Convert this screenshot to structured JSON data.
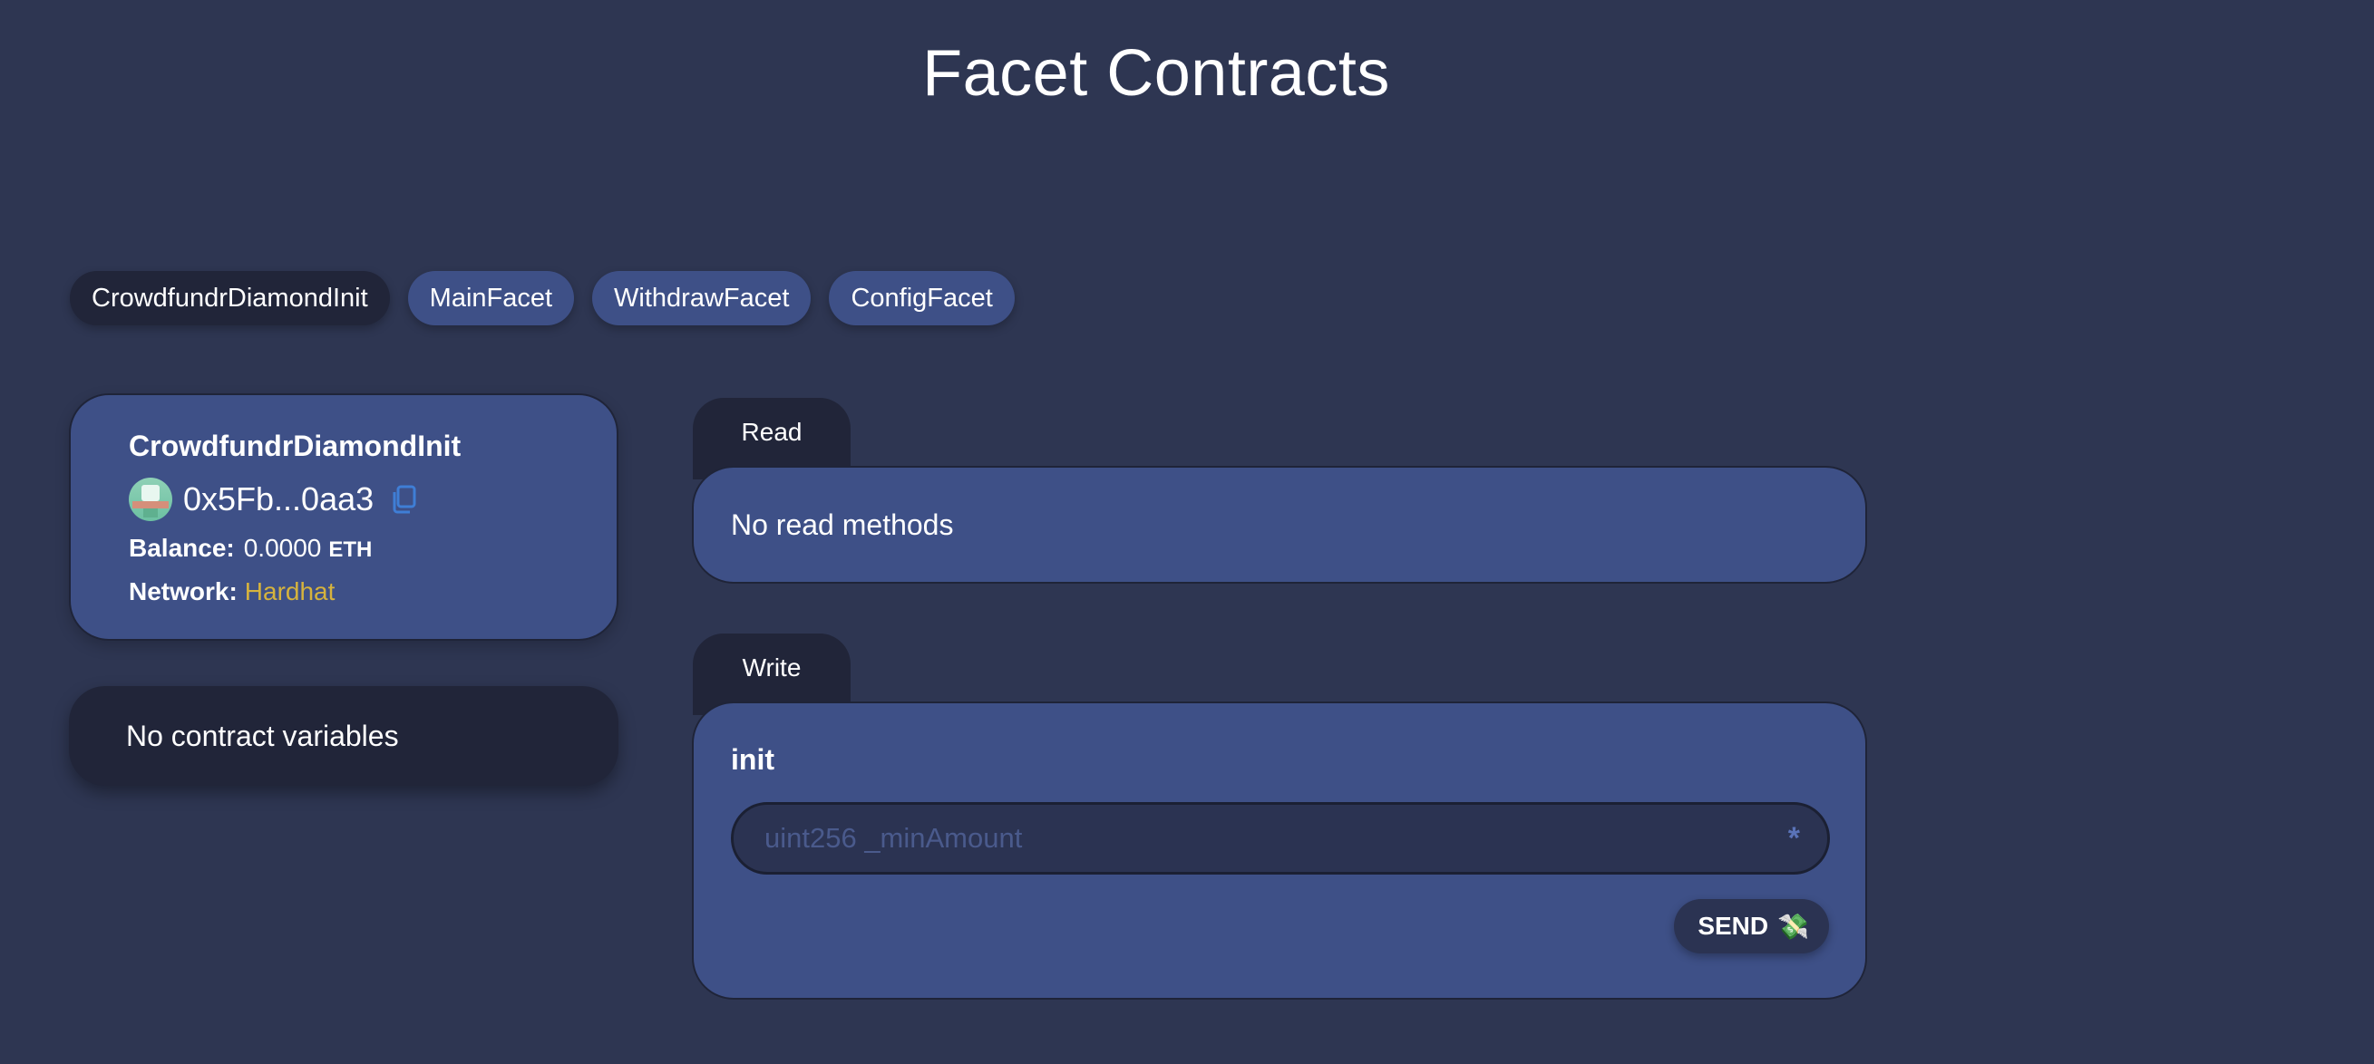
{
  "page": {
    "title": "Facet Contracts"
  },
  "facet_tabs": [
    {
      "label": "CrowdfundrDiamondInit",
      "active": true
    },
    {
      "label": "MainFacet",
      "active": false
    },
    {
      "label": "WithdrawFacet",
      "active": false
    },
    {
      "label": "ConfigFacet",
      "active": false
    }
  ],
  "contract": {
    "name": "CrowdfundrDiamondInit",
    "address": "0x5Fb...0aa3",
    "balance_label": "Balance:",
    "balance_value": "0.0000",
    "balance_unit": "ETH",
    "network_label": "Network:",
    "network_value": "Hardhat"
  },
  "variables": {
    "empty_text": "No contract variables"
  },
  "read": {
    "tab_label": "Read",
    "empty_text": "No read methods"
  },
  "write": {
    "tab_label": "Write",
    "method": "init",
    "input_placeholder": "uint256 _minAmount",
    "input_value": "",
    "required_marker": "*",
    "send_label": "SEND",
    "send_icon": "money-with-wings-icon"
  },
  "colors": {
    "background": "#2e3652",
    "card": "#3e5087",
    "dark": "#212539",
    "network": "#d6b33d",
    "copy_icon": "#3f7ed6"
  }
}
